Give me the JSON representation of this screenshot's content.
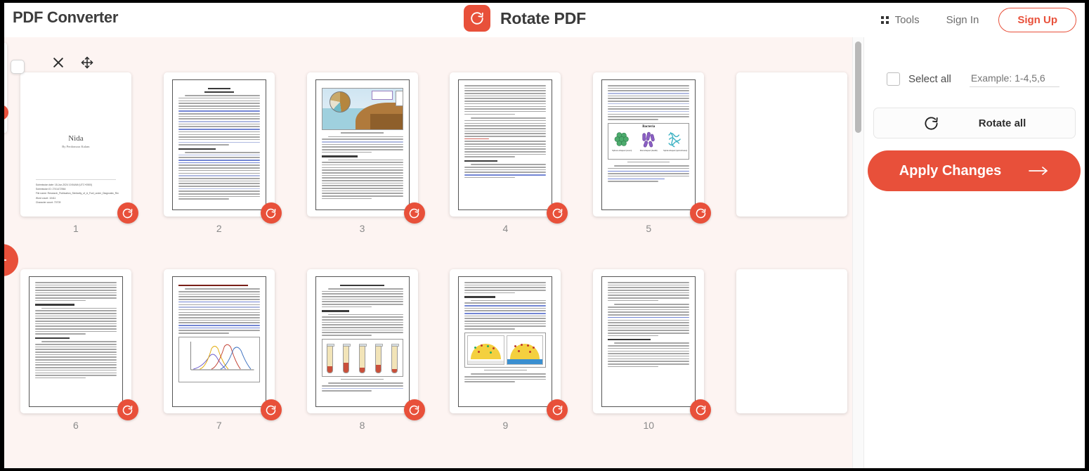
{
  "header": {
    "brand": "PDF Converter",
    "tool_title": "Rotate PDF",
    "logo_icon": "rotate-clockwise-icon",
    "tools_label": "Tools",
    "tools_icon": "grid-dots-icon",
    "signin_label": "Sign In",
    "signup_label": "Sign Up"
  },
  "colors": {
    "accent": "#e8503a",
    "workspace_bg": "#fdf4f2",
    "panel_bg": "#ffffff",
    "text_dark": "#3a3a3a",
    "text_muted": "#8a8a8a"
  },
  "sidebar": {
    "select_all_label": "Select all",
    "range_placeholder": "Example: 1-4,5,6",
    "range_value": "",
    "rotate_all_label": "Rotate all",
    "rotate_all_icon": "rotate-clockwise-icon",
    "apply_label": "Apply Changes",
    "apply_icon": "arrow-right-icon",
    "select_all_checked": false
  },
  "workspace": {
    "rotate_page_icon": "rotate-clockwise-icon",
    "hover_close_icon": "close-x-icon",
    "hover_move_icon": "move-arrows-icon",
    "hover_checkbox_icon": "checkbox-unchecked-icon",
    "pages": [
      {
        "num": "1",
        "type": "title",
        "hovered": true,
        "title": "Nida",
        "subtitle": "By Perdomora Kalam",
        "meta": [
          "Submission date: 18-Jun-2024 10:54AM (UTC+0500)",
          "Submission ID: 2741472564",
          "File name: Research_Publication_Similarity_of_A_Fuel_under_Diagnostic_Revitalisation.01.PDF",
          "Word count: 10411",
          "Character count: 70709"
        ]
      },
      {
        "num": "2",
        "type": "text-chapter"
      },
      {
        "num": "3",
        "type": "figure-environment"
      },
      {
        "num": "4",
        "type": "text-dense"
      },
      {
        "num": "5",
        "type": "figure-bacteria",
        "figure_title": "Bacteria",
        "figure_labels": [
          "Sphere-shaped (cocci)",
          "Rod-shaped (bacilli)",
          "Spiral-shaped (spirochetes)"
        ]
      },
      {
        "num": "6",
        "type": "text-plain"
      },
      {
        "num": "7",
        "type": "figure-linechart"
      },
      {
        "num": "8",
        "type": "figure-tubes"
      },
      {
        "num": "9",
        "type": "figure-panels"
      },
      {
        "num": "10",
        "type": "text-plain2"
      }
    ]
  },
  "scrollbar": {
    "name": "vertical-scrollbar",
    "thumb_position": "top"
  }
}
